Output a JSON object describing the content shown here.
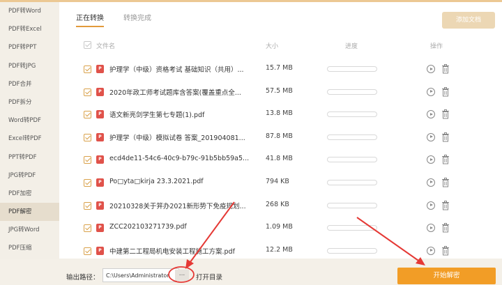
{
  "sidebar": {
    "items": [
      {
        "label": "PDF转Word"
      },
      {
        "label": "PDF转Excel"
      },
      {
        "label": "PDF转PPT"
      },
      {
        "label": "PDF转JPG"
      },
      {
        "label": "PDF合并"
      },
      {
        "label": "PDF拆分"
      },
      {
        "label": "Word转PDF"
      },
      {
        "label": "Excel转PDF"
      },
      {
        "label": "PPT转PDF"
      },
      {
        "label": "JPG转PDF"
      },
      {
        "label": "PDF加密"
      },
      {
        "label": "PDF解密",
        "active": true
      },
      {
        "label": "JPG转Word"
      },
      {
        "label": "PDF压缩"
      }
    ]
  },
  "tabs": [
    {
      "label": "正在转换",
      "active": true
    },
    {
      "label": "转换完成",
      "active": false
    }
  ],
  "add_doc_label": "添加文档",
  "table": {
    "columns": {
      "name": "文件名",
      "size": "大小",
      "progress": "进度",
      "actions": "操作"
    },
    "rows": [
      {
        "name": "护理学（中级）资格考试 基础知识（共用）...",
        "size": "15.7 MB",
        "progress": 0
      },
      {
        "name": "2020年政工师考试题库含答案(覆盖重点全...",
        "size": "57.5 MB",
        "progress": 0
      },
      {
        "name": "语文新亮剑学生第七专题(1).pdf",
        "size": "13.8 MB",
        "progress": 0
      },
      {
        "name": "护理学（中级）模拟试卷 答案_201904081...",
        "size": "87.8 MB",
        "progress": 0
      },
      {
        "name": "ecd4de11-54c6-40c9-b79c-91b5bb59a5...",
        "size": "41.8 MB",
        "progress": 0
      },
      {
        "name": "Po□yta□kirja 23.3.2021.pdf",
        "size": "794 KB",
        "progress": 0
      },
      {
        "name": "20210328关于笄办2021新形势下免疫规划...",
        "size": "268 KB",
        "progress": 0
      },
      {
        "name": "ZCC202103271739.pdf",
        "size": "1.09 MB",
        "progress": 0
      },
      {
        "name": "中建第二工程局机电安装工程施工方案.pdf",
        "size": "12.2 MB",
        "progress": 0
      }
    ]
  },
  "bottom": {
    "output_label": "输出路径：",
    "output_path": "C:\\Users\\Administrator",
    "browse_label": "...",
    "open_dir_label": "打开目录",
    "start_label": "开始解密"
  },
  "colors": {
    "accent": "#f29d26",
    "annotation": "#e53935",
    "pdf_icon": "#e0524a"
  },
  "icons": {
    "pdf_file": "pdf-file-icon",
    "play": "play-circle-icon",
    "trash": "trash-icon",
    "checkbox": "checkbox-checked-icon"
  }
}
